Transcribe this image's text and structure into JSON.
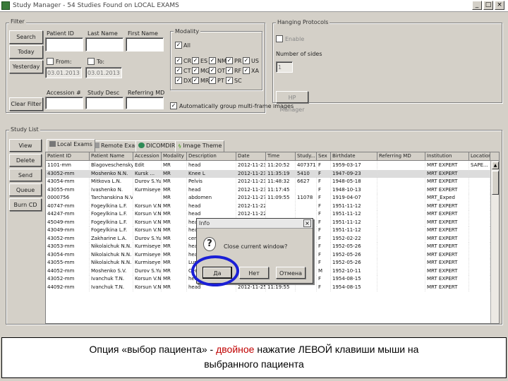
{
  "window": {
    "title": "Study Manager - 54 Studies Found on LOCAL EXAMS",
    "controls": [
      "_",
      "□",
      "×"
    ]
  },
  "filter": {
    "legend": "Filter",
    "buttons": [
      "Search",
      "Today",
      "Yesterday",
      "Clear Filter"
    ],
    "labels": {
      "patient_id": "Patient ID",
      "last_name": "Last Name",
      "first_name": "First Name",
      "from": "From:",
      "to": "To:",
      "accession": "Accession #",
      "study_desc": "Study Desc",
      "referring_md": "Referring MD"
    },
    "dates": {
      "from": "03.01.2013",
      "to": "03.01.2013"
    },
    "modality": {
      "legend": "Modality",
      "all_label": "All",
      "rows": [
        [
          "CR",
          "ES",
          "NM",
          "PR",
          "US"
        ],
        [
          "CT",
          "MG",
          "OT",
          "RF",
          "XA"
        ],
        [
          "DX",
          "MR",
          "PT",
          "SC"
        ]
      ]
    },
    "auto_group": "Automatically group multi-frame images"
  },
  "hanging": {
    "legend": "Hanging Protocols",
    "enable": "Enable",
    "num_sides_label": "Number of sides",
    "num_sides_value": "1",
    "button": "HP Manager"
  },
  "study_list": {
    "legend": "Study List",
    "side_buttons": [
      "View",
      "Delete",
      "Send",
      "Queue",
      "Burn CD"
    ],
    "tabs": [
      "Local Exams",
      "Remote Exams",
      "DICOMDIR",
      "Image Theme"
    ],
    "columns": [
      "Patient ID",
      "Patient Name",
      "Accession",
      "Modality",
      "Description",
      "Date",
      "Time",
      "Study...",
      "Sex",
      "Birthdate",
      "Referring MD",
      "Institution",
      "Location"
    ],
    "rows": [
      [
        "1101-mm",
        "Blagoveschensky...",
        "Edit",
        "MR",
        "head",
        "2012-11-23",
        "11:20:52",
        "4073710",
        "F",
        "1959-03-17",
        "",
        "MRT EXPERT",
        "SAPE..."
      ],
      [
        "43052-mm",
        "Moshenko N.N.",
        "Kursk ...",
        "MR",
        "Knee L",
        "2012-11-23",
        "11:35:19",
        "5410",
        "F",
        "1947-09-23",
        "",
        "MRT EXPERT",
        ""
      ],
      [
        "43054-mm",
        "Mitkova L.N.",
        "Durov S.Yu.",
        "MR",
        "Pelvis",
        "2012-11-23",
        "11:48:32",
        "6627",
        "F",
        "1948-05-18",
        "",
        "MRT EXPERT",
        ""
      ],
      [
        "43055-mm",
        "Ivashenko N.",
        "Kurmiseye...",
        "MR",
        "head",
        "2012-11-23",
        "11:17:45",
        "",
        "F",
        "1948-10-13",
        "",
        "MRT EXPERT",
        ""
      ],
      [
        "0000756",
        "Tarchanskina N.V.",
        "",
        "MR",
        "abdomen",
        "2012-11-27",
        "11:09:55",
        "11078",
        "F",
        "1919-04-07",
        "",
        "MRT_Exped",
        ""
      ],
      [
        "40747-mm",
        "Fogeylkina L.F.",
        "Korsun V.N.",
        "MR",
        "head",
        "2012-11-22",
        "",
        "",
        "F",
        "1951-11-12",
        "",
        "MRT EXPERT",
        ""
      ],
      [
        "44247-mm",
        "Fogeylkina L.F.",
        "Korsun V.N.",
        "MR",
        "head",
        "2012-11-22",
        "",
        "",
        "F",
        "1951-11-12",
        "",
        "MRT EXPERT",
        ""
      ],
      [
        "45049-mm",
        "Fogeylkina L.F.",
        "Korsun V.N.",
        "MR",
        "head",
        "2012-11-22",
        "",
        "",
        "F",
        "1951-11-12",
        "",
        "MRT EXPERT",
        ""
      ],
      [
        "43049-mm",
        "Fogeylkina L.F.",
        "Korsun V.N.",
        "MR",
        "head",
        "2012-11-22",
        "",
        "",
        "F",
        "1951-11-12",
        "",
        "MRT EXPERT",
        ""
      ],
      [
        "43052-mm",
        "Zakharine L.A.",
        "Durov S.Yu.",
        "MR",
        "cervi...",
        "2012-11-22",
        "",
        "",
        "F",
        "1952-02-22",
        "",
        "MRT EXPERT",
        ""
      ],
      [
        "43053-mm",
        "Nikolaichuk N.N.",
        "Kurmiseye...",
        "MR",
        "head",
        "2012-11-22",
        "",
        "",
        "F",
        "1952-05-26",
        "",
        "MRT EXPERT",
        ""
      ],
      [
        "43054-mm",
        "Nikolaichuk N.N.",
        "Kurmiseye...",
        "MR",
        "head",
        "2012-11-22",
        "",
        "",
        "F",
        "1952-05-26",
        "",
        "MRT EXPERT",
        ""
      ],
      [
        "43055-mm",
        "Nikolaichuk N.N.",
        "Kurmiseye...",
        "MR",
        "Lumbar/Coccyx",
        "2012-11-24",
        "11:22:21",
        "8103",
        "F",
        "1952-05-26",
        "",
        "MRT EXPERT",
        ""
      ],
      [
        "44052-mm",
        "Moshenko S.V.",
        "Durov S.Yu.",
        "MR",
        "Cervic",
        "2012-11-25",
        "11:19:55",
        "6104",
        "M",
        "1952-10-11",
        "",
        "MRT EXPERT",
        ""
      ],
      [
        "43052-mm",
        "Ivanchuk T.N.",
        "Korsun V.N.",
        "MR",
        "head",
        "2012-11-25",
        "11:09:55",
        "1104",
        "F",
        "1954-08-15",
        "",
        "MRT EXPERT",
        ""
      ],
      [
        "44092-mm",
        "Ivanchuk T.N.",
        "Korsun V.N.",
        "MR",
        "head",
        "2012-11-25",
        "11:19:55",
        "",
        "F",
        "1954-08-15",
        "",
        "MRT EXPERT",
        ""
      ]
    ]
  },
  "dialog": {
    "title": "Info",
    "message": "Close current window?",
    "buttons": [
      "Да",
      "Нет",
      "Отмена"
    ]
  },
  "caption": {
    "part1": "Опция «выбор пациента» - ",
    "emphasis": "двойное",
    "part2": " нажатие ЛЕВОЙ клавиши мыши на",
    "line2": "выбранного пациента"
  },
  "colors": {
    "highlight_ring": "#1a1fd6",
    "emphasis": "#c00000",
    "window_bg": "#d4d0c8"
  }
}
